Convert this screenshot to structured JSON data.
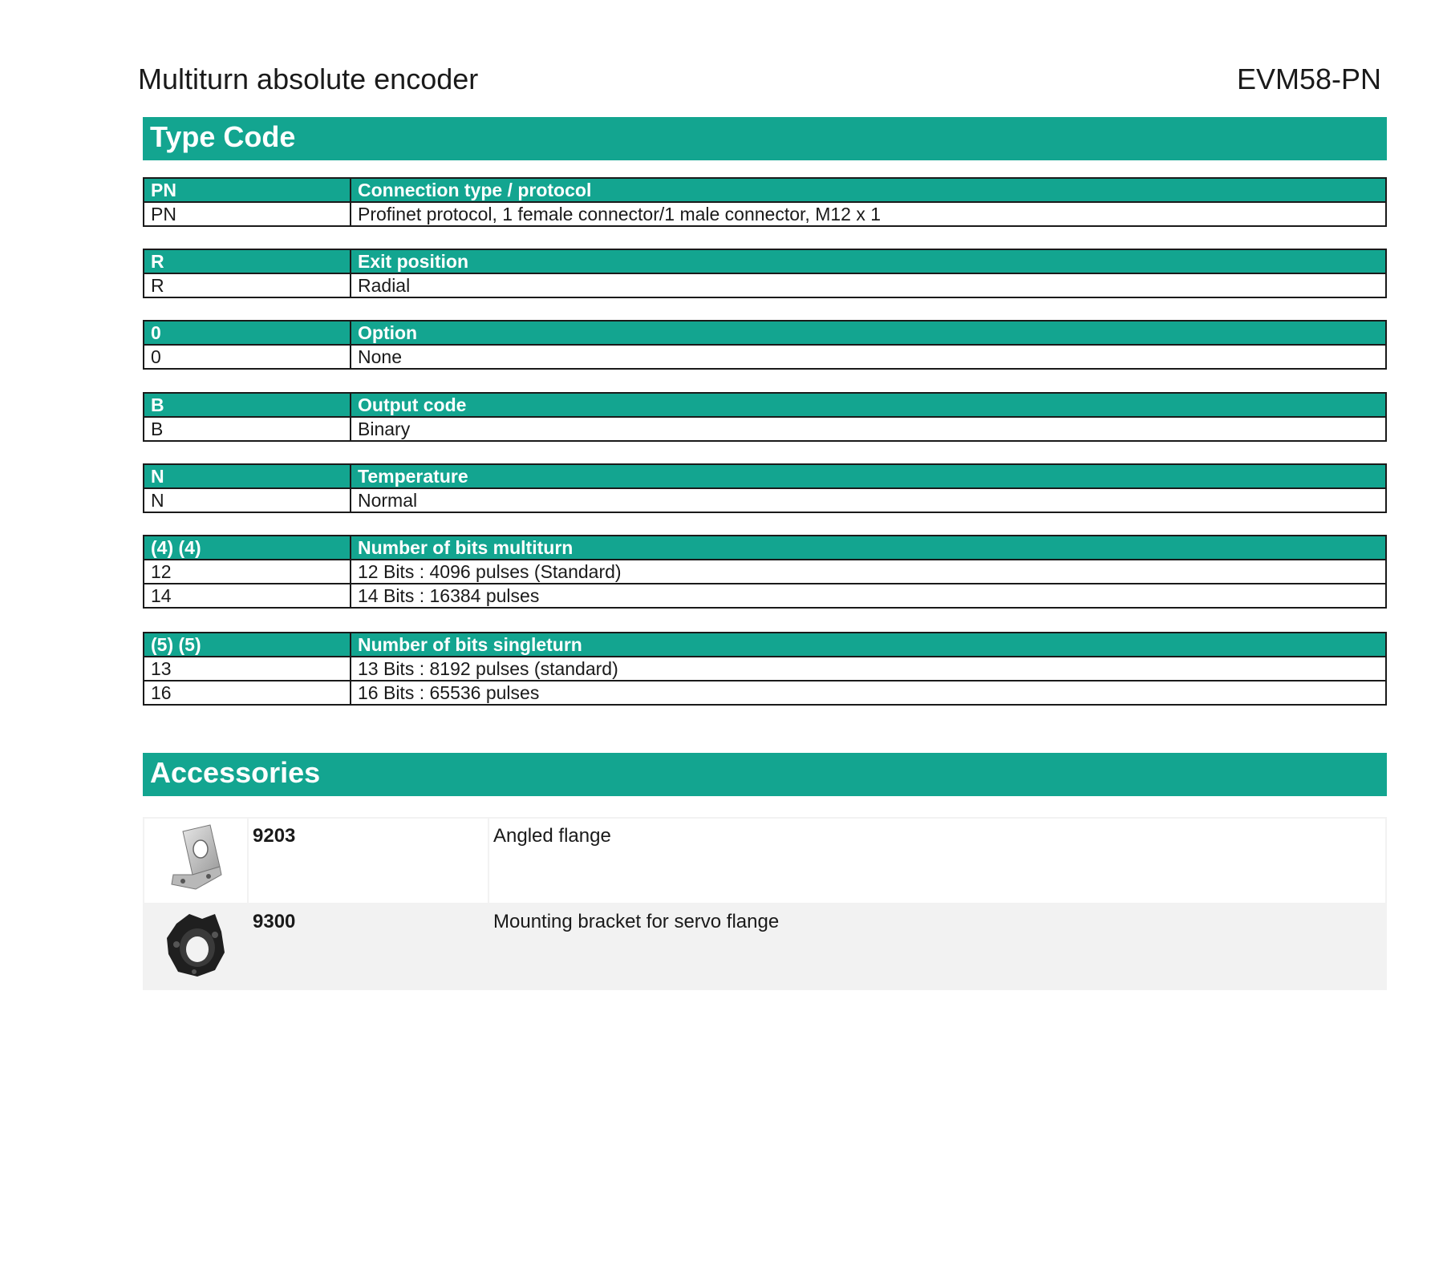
{
  "header": {
    "title": "Multiturn absolute encoder",
    "product": "EVM58-PN"
  },
  "type_code": {
    "heading": "Type Code",
    "tables": [
      {
        "code": "PN",
        "label": "Connection type / protocol",
        "rows": [
          [
            "PN",
            "Profinet protocol, 1 female connector/1 male connector, M12 x 1"
          ]
        ]
      },
      {
        "code": "R",
        "label": "Exit position",
        "rows": [
          [
            "R",
            "Radial"
          ]
        ]
      },
      {
        "code": "0",
        "label": "Option",
        "rows": [
          [
            "0",
            "None"
          ]
        ]
      },
      {
        "code": "B",
        "label": "Output code",
        "rows": [
          [
            "B",
            "Binary"
          ]
        ]
      },
      {
        "code": "N",
        "label": "Temperature",
        "rows": [
          [
            "N",
            "Normal"
          ]
        ]
      },
      {
        "code": "(4) (4)",
        "label": "Number of bits multiturn",
        "rows": [
          [
            "12",
            "12 Bits : 4096 pulses (Standard)"
          ],
          [
            "14",
            "14 Bits : 16384 pulses"
          ]
        ]
      },
      {
        "code": "(5) (5)",
        "label": "Number of bits singleturn",
        "rows": [
          [
            "13",
            "13 Bits : 8192 pulses (standard)"
          ],
          [
            "16",
            "16 Bits : 65536 pulses"
          ]
        ]
      }
    ]
  },
  "accessories": {
    "heading": "Accessories",
    "items": [
      {
        "number": "9203",
        "description": "Angled flange",
        "image": "angled-flange-image"
      },
      {
        "number": "9300",
        "description": "Mounting bracket for servo flange",
        "image": "mounting-bracket-image"
      }
    ]
  },
  "colors": {
    "accent": "#13a590",
    "row_alt": "#f2f2f2"
  }
}
